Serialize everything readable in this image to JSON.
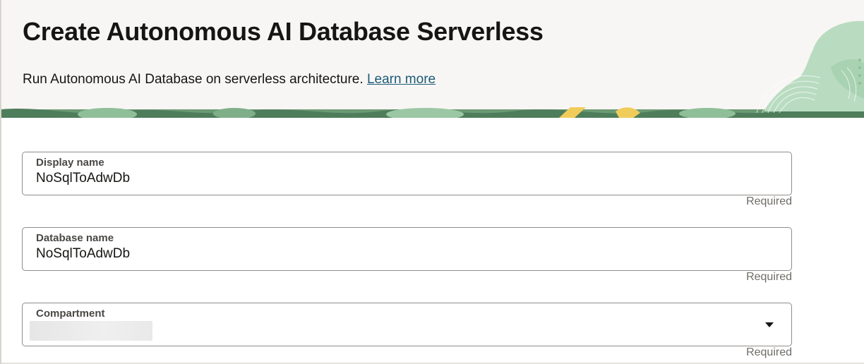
{
  "header": {
    "title": "Create Autonomous AI Database Serverless",
    "subtitle": "Run Autonomous AI Database on serverless architecture.",
    "learn_more_label": "Learn more"
  },
  "form": {
    "display_name": {
      "label": "Display name",
      "value": "NoSqlToAdwDb",
      "hint": "Required"
    },
    "database_name": {
      "label": "Database name",
      "value": "NoSqlToAdwDb",
      "hint": "Required"
    },
    "compartment": {
      "label": "Compartment",
      "hint": "Required"
    }
  },
  "colors": {
    "header_background": "#f8f6f4",
    "link": "#1d5b79",
    "field_border": "#8f8c88",
    "art_dark_green": "#4e7d5b",
    "art_light_green": "#b9dcc1",
    "art_yellow": "#f0cc5a"
  },
  "icons": {
    "dropdown": "caret-down-icon"
  }
}
